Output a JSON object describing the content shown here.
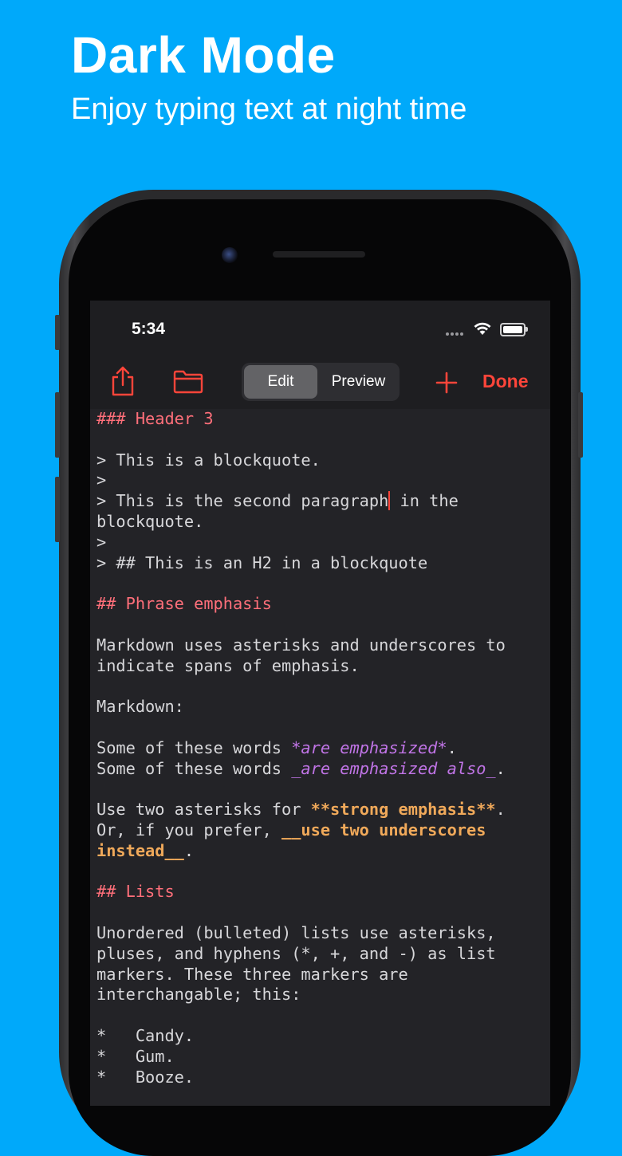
{
  "promo": {
    "title": "Dark Mode",
    "subtitle": "Enjoy typing text at night time"
  },
  "status_bar": {
    "time": "5:34"
  },
  "toolbar": {
    "share_icon": "share-icon",
    "folder_icon": "folder-icon",
    "segments": {
      "edit": "Edit",
      "preview": "Preview"
    },
    "active_segment": "Edit",
    "add_icon": "plus-icon",
    "done_label": "Done"
  },
  "editor": {
    "l1": "### Header 3",
    "l2": "",
    "l3": "> This is a blockquote.",
    "l4": ">",
    "l5a": "> This is the second paragraph",
    "l5b": " in the",
    "l6": "blockquote.",
    "l7": ">",
    "l8": "> ## This is an H2 in a blockquote",
    "l9": "",
    "l10": "## Phrase emphasis",
    "l11": "",
    "l12": "Markdown uses asterisks and underscores to",
    "l13": "indicate spans of emphasis.",
    "l14": "",
    "l15": "Markdown:",
    "l16": "",
    "l17a": "Some of these words ",
    "l17b": "*are emphasized*",
    "l17c": ".",
    "l18a": "Some of these words ",
    "l18b": "_are emphasized also_",
    "l18c": ".",
    "l19": "",
    "l20a": "Use two asterisks for ",
    "l20b": "**strong emphasis**",
    "l20c": ".",
    "l21a": "Or, if you prefer, ",
    "l21b": "__use two underscores",
    "l22a": "instead__",
    "l22b": ".",
    "l23": "",
    "l24": "## Lists",
    "l25": "",
    "l26": "Unordered (bulleted) lists use asterisks,",
    "l27": "pluses, and hyphens (*, +, and -) as list",
    "l28": "markers. These three markers are",
    "l29": "interchangable; this:",
    "l30": "",
    "l31": "*   Candy.",
    "l32": "*   Gum.",
    "l33": "*   Booze."
  },
  "colors": {
    "background": "#00a9fa",
    "editor_bg": "#232327",
    "accent": "#ff453a",
    "header_text": "#ff6f7a",
    "emphasis": "#c074e6",
    "strong": "#f0a95a"
  }
}
